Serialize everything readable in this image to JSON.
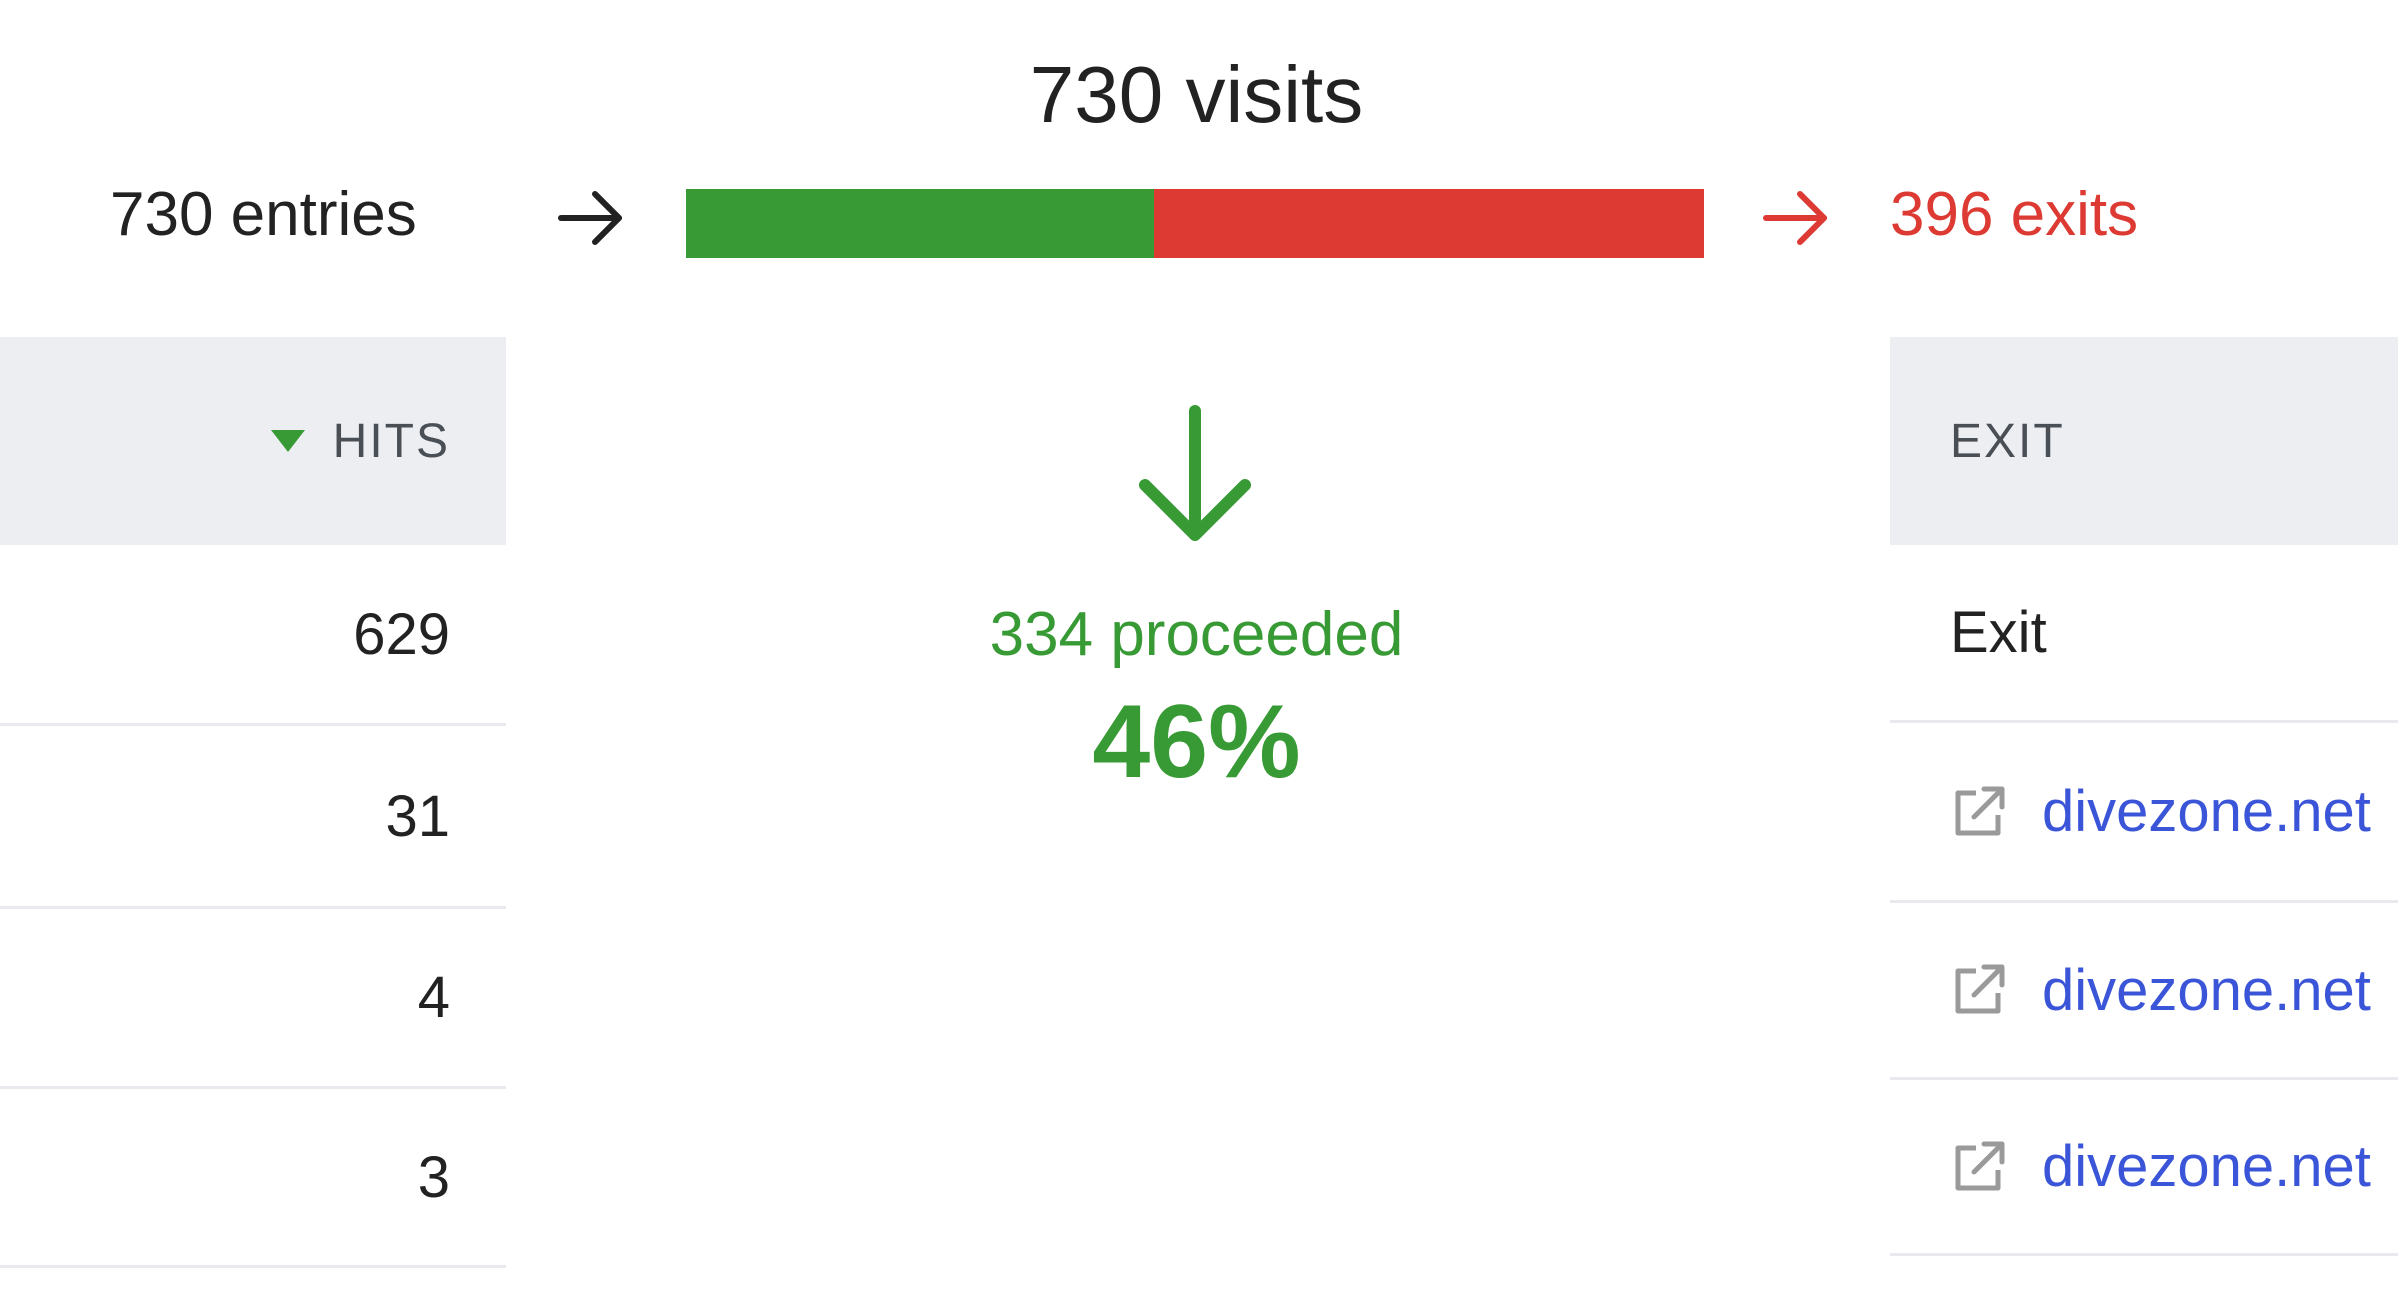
{
  "summary": {
    "visits_label": "730 visits",
    "entries_label": "730 entries",
    "exits_label": "396 exits",
    "proceeded_label": "334 proceeded",
    "proceeded_percent_label": "46%",
    "proceed_fraction": 0.46,
    "colors": {
      "proceed": "#379a34",
      "exit": "#dc3a33",
      "link": "#3b55d8"
    }
  },
  "left_table": {
    "hits_header": "HITS",
    "sort_icon": "sort-descending-triangle-icon",
    "rows": [
      {
        "hits": "629"
      },
      {
        "hits": "31"
      },
      {
        "hits": "4"
      },
      {
        "hits": "3"
      }
    ]
  },
  "right_table": {
    "exit_header": "EXIT",
    "rows": [
      {
        "label": "Exit",
        "is_link": false
      },
      {
        "label": "divezone.net",
        "is_link": true,
        "icon": "external-link-icon"
      },
      {
        "label": "divezone.net",
        "is_link": true,
        "icon": "external-link-icon"
      },
      {
        "label": "divezone.net",
        "is_link": true,
        "icon": "external-link-icon"
      }
    ]
  }
}
